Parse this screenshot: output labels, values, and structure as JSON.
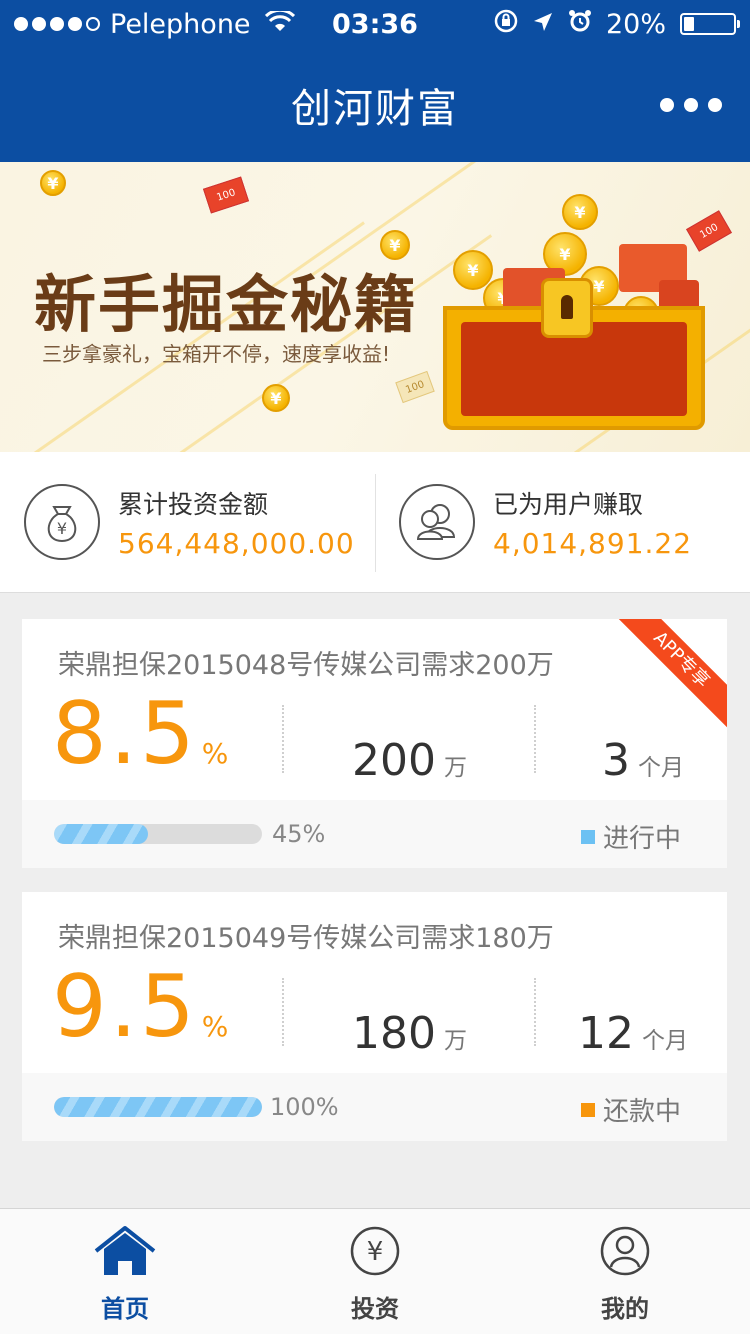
{
  "status_bar": {
    "carrier": "Pelephone",
    "time": "03:36",
    "battery": "20%",
    "battery_level": 0.2
  },
  "header": {
    "title": "创河财富"
  },
  "banner": {
    "headline": "新手掘金秘籍",
    "subtitle": "三步拿豪礼，宝箱开不停，速度享收益!",
    "note_text": "100",
    "coin_symbol": "¥",
    "active_slide": 0,
    "slide_count": 5
  },
  "stats": {
    "total_invest_label": "累计投资金额",
    "total_invest_value": "564,448,000.00",
    "earned_label": "已为用户赚取",
    "earned_value": "4,014,891.22",
    "yen_symbol": "¥"
  },
  "products": [
    {
      "name": "荣鼎担保2015048号传媒公司需求200万",
      "rate": "8.5",
      "rate_unit": "%",
      "amount": "200",
      "amount_unit": "万",
      "term": "3",
      "term_unit": "个月",
      "progress": 0.45,
      "progress_text": "45%",
      "status": "进行中",
      "status_color": "#6cc1f3",
      "ribbon": "APP专享"
    },
    {
      "name": "荣鼎担保2015049号传媒公司需求180万",
      "rate": "9.5",
      "rate_unit": "%",
      "amount": "180",
      "amount_unit": "万",
      "term": "12",
      "term_unit": "个月",
      "progress": 1.0,
      "progress_text": "100%",
      "status": "还款中",
      "status_color": "#f7960d"
    }
  ],
  "tabbar": {
    "home": "首页",
    "invest": "投资",
    "mine": "我的",
    "yen_symbol": "¥"
  },
  "colors": {
    "brand_blue": "#0c4ea2",
    "accent_orange": "#f7960d",
    "progress_blue": "#7dc6f5"
  }
}
